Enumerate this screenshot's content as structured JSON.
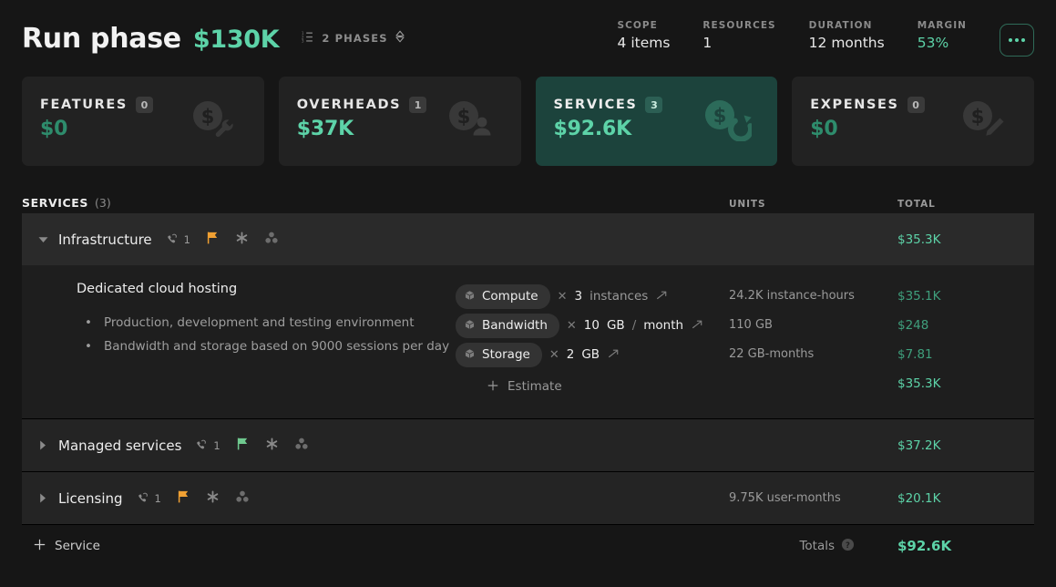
{
  "header": {
    "title": "Run phase",
    "amount": "$130K",
    "phases_label": "2 PHASES",
    "phases_icon": "list-ordered-icon",
    "phases_selector_icon": "chevron-up-down-icon",
    "more_icon": "ellipsis-icon",
    "stats": [
      {
        "label": "SCOPE",
        "value": "4 items",
        "accent": false
      },
      {
        "label": "RESOURCES",
        "value": "1",
        "accent": false
      },
      {
        "label": "DURATION",
        "value": "12 months",
        "accent": false
      },
      {
        "label": "MARGIN",
        "value": "53%",
        "accent": true
      }
    ]
  },
  "cards": [
    {
      "name": "FEATURES",
      "count": "0",
      "value": "$0",
      "active": false,
      "icon": "dollar-coin-wrench-icon"
    },
    {
      "name": "OVERHEADS",
      "count": "1",
      "value": "$37K",
      "active": false,
      "icon": "dollar-coin-person-icon"
    },
    {
      "name": "SERVICES",
      "count": "3",
      "value": "$92.6K",
      "active": true,
      "icon": "dollar-coin-refresh-icon"
    },
    {
      "name": "EXPENSES",
      "count": "0",
      "value": "$0",
      "active": false,
      "icon": "dollar-coin-pencil-icon"
    }
  ],
  "table": {
    "title": "SERVICES",
    "count": "(3)",
    "col_units": "UNITS",
    "col_total": "TOTAL",
    "groups": [
      {
        "name": "Infrastructure",
        "expanded": true,
        "call_count": "1",
        "flag_color": "#f0a033",
        "units": "",
        "total": "$35.3K",
        "item": {
          "title": "Dedicated cloud hosting",
          "bullets": [
            "Production, development and testing environment",
            "Bandwidth and storage based on 9000 sessions per day"
          ],
          "lines": [
            {
              "chip": "Compute",
              "qty": "3",
              "unit": "instances",
              "per": "",
              "units": "24.2K instance-hours",
              "total": "$35.1K"
            },
            {
              "chip": "Bandwidth",
              "qty": "10",
              "unit": "GB",
              "per": "month",
              "units": "110 GB",
              "total": "$248"
            },
            {
              "chip": "Storage",
              "qty": "2",
              "unit": "GB",
              "per": "",
              "units": "22 GB-months",
              "total": "$7.81"
            }
          ],
          "estimate_label": "Estimate",
          "estimate_total": "$35.3K"
        }
      },
      {
        "name": "Managed services",
        "expanded": false,
        "call_count": "1",
        "flag_color": "#6fc98f",
        "units": "",
        "total": "$37.2K"
      },
      {
        "name": "Licensing",
        "expanded": false,
        "call_count": "1",
        "flag_color": "#f0a033",
        "units": "9.75K user-months",
        "total": "$20.1K"
      }
    ]
  },
  "footer": {
    "add_label": "Service",
    "add_icon": "plus-icon",
    "totals_label": "Totals",
    "help_icon": "help-circle-icon",
    "grand_total": "$92.6K"
  },
  "colors": {
    "accent": "#5dd3a8",
    "accent_dim": "#3f9f7c",
    "page_bg": "#161616",
    "card_bg": "#222222",
    "card_active_bg": "#1c433c",
    "row_bg": "#2a2a2a",
    "flag_orange": "#f0a033",
    "flag_green": "#6fc98f"
  }
}
